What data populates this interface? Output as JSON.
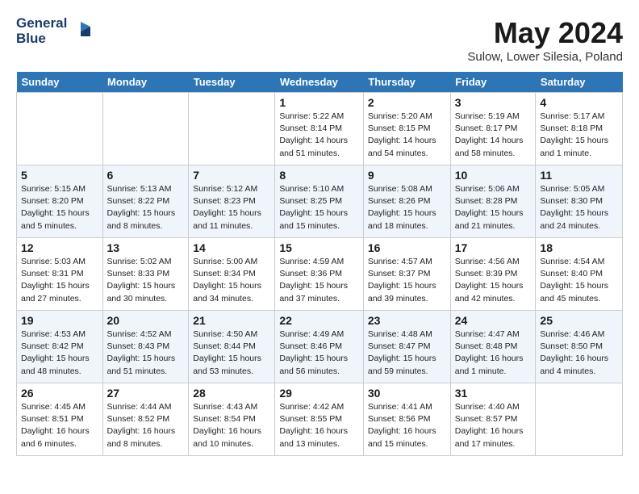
{
  "header": {
    "logo_line1": "General",
    "logo_line2": "Blue",
    "month_title": "May 2024",
    "location": "Sulow, Lower Silesia, Poland"
  },
  "days_of_week": [
    "Sunday",
    "Monday",
    "Tuesday",
    "Wednesday",
    "Thursday",
    "Friday",
    "Saturday"
  ],
  "weeks": [
    [
      {
        "num": "",
        "sunrise": "",
        "sunset": "",
        "daylight": ""
      },
      {
        "num": "",
        "sunrise": "",
        "sunset": "",
        "daylight": ""
      },
      {
        "num": "",
        "sunrise": "",
        "sunset": "",
        "daylight": ""
      },
      {
        "num": "1",
        "sunrise": "Sunrise: 5:22 AM",
        "sunset": "Sunset: 8:14 PM",
        "daylight": "Daylight: 14 hours and 51 minutes."
      },
      {
        "num": "2",
        "sunrise": "Sunrise: 5:20 AM",
        "sunset": "Sunset: 8:15 PM",
        "daylight": "Daylight: 14 hours and 54 minutes."
      },
      {
        "num": "3",
        "sunrise": "Sunrise: 5:19 AM",
        "sunset": "Sunset: 8:17 PM",
        "daylight": "Daylight: 14 hours and 58 minutes."
      },
      {
        "num": "4",
        "sunrise": "Sunrise: 5:17 AM",
        "sunset": "Sunset: 8:18 PM",
        "daylight": "Daylight: 15 hours and 1 minute."
      }
    ],
    [
      {
        "num": "5",
        "sunrise": "Sunrise: 5:15 AM",
        "sunset": "Sunset: 8:20 PM",
        "daylight": "Daylight: 15 hours and 5 minutes."
      },
      {
        "num": "6",
        "sunrise": "Sunrise: 5:13 AM",
        "sunset": "Sunset: 8:22 PM",
        "daylight": "Daylight: 15 hours and 8 minutes."
      },
      {
        "num": "7",
        "sunrise": "Sunrise: 5:12 AM",
        "sunset": "Sunset: 8:23 PM",
        "daylight": "Daylight: 15 hours and 11 minutes."
      },
      {
        "num": "8",
        "sunrise": "Sunrise: 5:10 AM",
        "sunset": "Sunset: 8:25 PM",
        "daylight": "Daylight: 15 hours and 15 minutes."
      },
      {
        "num": "9",
        "sunrise": "Sunrise: 5:08 AM",
        "sunset": "Sunset: 8:26 PM",
        "daylight": "Daylight: 15 hours and 18 minutes."
      },
      {
        "num": "10",
        "sunrise": "Sunrise: 5:06 AM",
        "sunset": "Sunset: 8:28 PM",
        "daylight": "Daylight: 15 hours and 21 minutes."
      },
      {
        "num": "11",
        "sunrise": "Sunrise: 5:05 AM",
        "sunset": "Sunset: 8:30 PM",
        "daylight": "Daylight: 15 hours and 24 minutes."
      }
    ],
    [
      {
        "num": "12",
        "sunrise": "Sunrise: 5:03 AM",
        "sunset": "Sunset: 8:31 PM",
        "daylight": "Daylight: 15 hours and 27 minutes."
      },
      {
        "num": "13",
        "sunrise": "Sunrise: 5:02 AM",
        "sunset": "Sunset: 8:33 PM",
        "daylight": "Daylight: 15 hours and 30 minutes."
      },
      {
        "num": "14",
        "sunrise": "Sunrise: 5:00 AM",
        "sunset": "Sunset: 8:34 PM",
        "daylight": "Daylight: 15 hours and 34 minutes."
      },
      {
        "num": "15",
        "sunrise": "Sunrise: 4:59 AM",
        "sunset": "Sunset: 8:36 PM",
        "daylight": "Daylight: 15 hours and 37 minutes."
      },
      {
        "num": "16",
        "sunrise": "Sunrise: 4:57 AM",
        "sunset": "Sunset: 8:37 PM",
        "daylight": "Daylight: 15 hours and 39 minutes."
      },
      {
        "num": "17",
        "sunrise": "Sunrise: 4:56 AM",
        "sunset": "Sunset: 8:39 PM",
        "daylight": "Daylight: 15 hours and 42 minutes."
      },
      {
        "num": "18",
        "sunrise": "Sunrise: 4:54 AM",
        "sunset": "Sunset: 8:40 PM",
        "daylight": "Daylight: 15 hours and 45 minutes."
      }
    ],
    [
      {
        "num": "19",
        "sunrise": "Sunrise: 4:53 AM",
        "sunset": "Sunset: 8:42 PM",
        "daylight": "Daylight: 15 hours and 48 minutes."
      },
      {
        "num": "20",
        "sunrise": "Sunrise: 4:52 AM",
        "sunset": "Sunset: 8:43 PM",
        "daylight": "Daylight: 15 hours and 51 minutes."
      },
      {
        "num": "21",
        "sunrise": "Sunrise: 4:50 AM",
        "sunset": "Sunset: 8:44 PM",
        "daylight": "Daylight: 15 hours and 53 minutes."
      },
      {
        "num": "22",
        "sunrise": "Sunrise: 4:49 AM",
        "sunset": "Sunset: 8:46 PM",
        "daylight": "Daylight: 15 hours and 56 minutes."
      },
      {
        "num": "23",
        "sunrise": "Sunrise: 4:48 AM",
        "sunset": "Sunset: 8:47 PM",
        "daylight": "Daylight: 15 hours and 59 minutes."
      },
      {
        "num": "24",
        "sunrise": "Sunrise: 4:47 AM",
        "sunset": "Sunset: 8:48 PM",
        "daylight": "Daylight: 16 hours and 1 minute."
      },
      {
        "num": "25",
        "sunrise": "Sunrise: 4:46 AM",
        "sunset": "Sunset: 8:50 PM",
        "daylight": "Daylight: 16 hours and 4 minutes."
      }
    ],
    [
      {
        "num": "26",
        "sunrise": "Sunrise: 4:45 AM",
        "sunset": "Sunset: 8:51 PM",
        "daylight": "Daylight: 16 hours and 6 minutes."
      },
      {
        "num": "27",
        "sunrise": "Sunrise: 4:44 AM",
        "sunset": "Sunset: 8:52 PM",
        "daylight": "Daylight: 16 hours and 8 minutes."
      },
      {
        "num": "28",
        "sunrise": "Sunrise: 4:43 AM",
        "sunset": "Sunset: 8:54 PM",
        "daylight": "Daylight: 16 hours and 10 minutes."
      },
      {
        "num": "29",
        "sunrise": "Sunrise: 4:42 AM",
        "sunset": "Sunset: 8:55 PM",
        "daylight": "Daylight: 16 hours and 13 minutes."
      },
      {
        "num": "30",
        "sunrise": "Sunrise: 4:41 AM",
        "sunset": "Sunset: 8:56 PM",
        "daylight": "Daylight: 16 hours and 15 minutes."
      },
      {
        "num": "31",
        "sunrise": "Sunrise: 4:40 AM",
        "sunset": "Sunset: 8:57 PM",
        "daylight": "Daylight: 16 hours and 17 minutes."
      },
      {
        "num": "",
        "sunrise": "",
        "sunset": "",
        "daylight": ""
      }
    ]
  ]
}
